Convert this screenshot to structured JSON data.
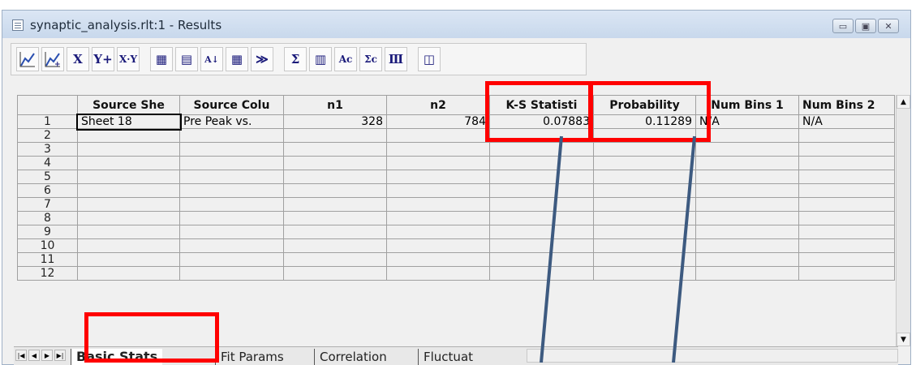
{
  "window": {
    "title": "synaptic_analysis.rlt:1 - Results",
    "buttons": [
      "minimize",
      "maximize",
      "close"
    ]
  },
  "toolbar": {
    "items": [
      {
        "name": "line-plot-icon",
        "glyph": "⟋"
      },
      {
        "name": "add-plot-icon",
        "glyph": "⟋+"
      },
      {
        "name": "x-axis-button",
        "glyph": "X"
      },
      {
        "name": "y-plus-button",
        "glyph": "Y+"
      },
      {
        "name": "xy-button",
        "glyph": "X·Y"
      },
      {
        "name": "table-options-icon",
        "glyph": "▦"
      },
      {
        "name": "notebook-icon",
        "glyph": "▤"
      },
      {
        "name": "sort-az-icon",
        "glyph": "A↓Z"
      },
      {
        "name": "grid-select-icon",
        "glyph": "▦"
      },
      {
        "name": "fit-curve-icon",
        "glyph": "≫"
      },
      {
        "name": "sum-button",
        "glyph": "Σ"
      },
      {
        "name": "histogram-icon",
        "glyph": "▥"
      },
      {
        "name": "column-stats-icon",
        "glyph": "Ac"
      },
      {
        "name": "sum-column-icon",
        "glyph": "Σc"
      },
      {
        "name": "events-icon",
        "glyph": "Ⅲ"
      },
      {
        "name": "export-icon",
        "glyph": "◫"
      }
    ]
  },
  "table": {
    "headers": [
      "Source She",
      "Source Colu",
      "n1",
      "n2",
      "K-S Statisti",
      "Probability",
      "Num Bins 1",
      "Num Bins 2"
    ],
    "rows": [
      [
        "1",
        "Sheet 18",
        "Pre Peak vs.",
        "328",
        "784",
        "0.07883",
        "0.11289",
        "N/A",
        "N/A"
      ],
      [
        "2",
        "",
        "",
        "",
        "",
        "",
        "",
        "",
        ""
      ],
      [
        "3",
        "",
        "",
        "",
        "",
        "",
        "",
        "",
        ""
      ],
      [
        "4",
        "",
        "",
        "",
        "",
        "",
        "",
        "",
        ""
      ],
      [
        "5",
        "",
        "",
        "",
        "",
        "",
        "",
        "",
        ""
      ],
      [
        "6",
        "",
        "",
        "",
        "",
        "",
        "",
        "",
        ""
      ],
      [
        "7",
        "",
        "",
        "",
        "",
        "",
        "",
        "",
        ""
      ],
      [
        "8",
        "",
        "",
        "",
        "",
        "",
        "",
        "",
        ""
      ],
      [
        "9",
        "",
        "",
        "",
        "",
        "",
        "",
        "",
        ""
      ],
      [
        "10",
        "",
        "",
        "",
        "",
        "",
        "",
        "",
        ""
      ],
      [
        "11",
        "",
        "",
        "",
        "",
        "",
        "",
        "",
        ""
      ],
      [
        "12",
        "",
        "",
        "",
        "",
        "",
        "",
        "",
        ""
      ]
    ]
  },
  "tabs": [
    "Basic Stats",
    "Fit Params",
    "Correlation",
    "Fluctuat"
  ],
  "colors": {
    "highlight": "#ff0000",
    "leader": "#3d5a80"
  }
}
